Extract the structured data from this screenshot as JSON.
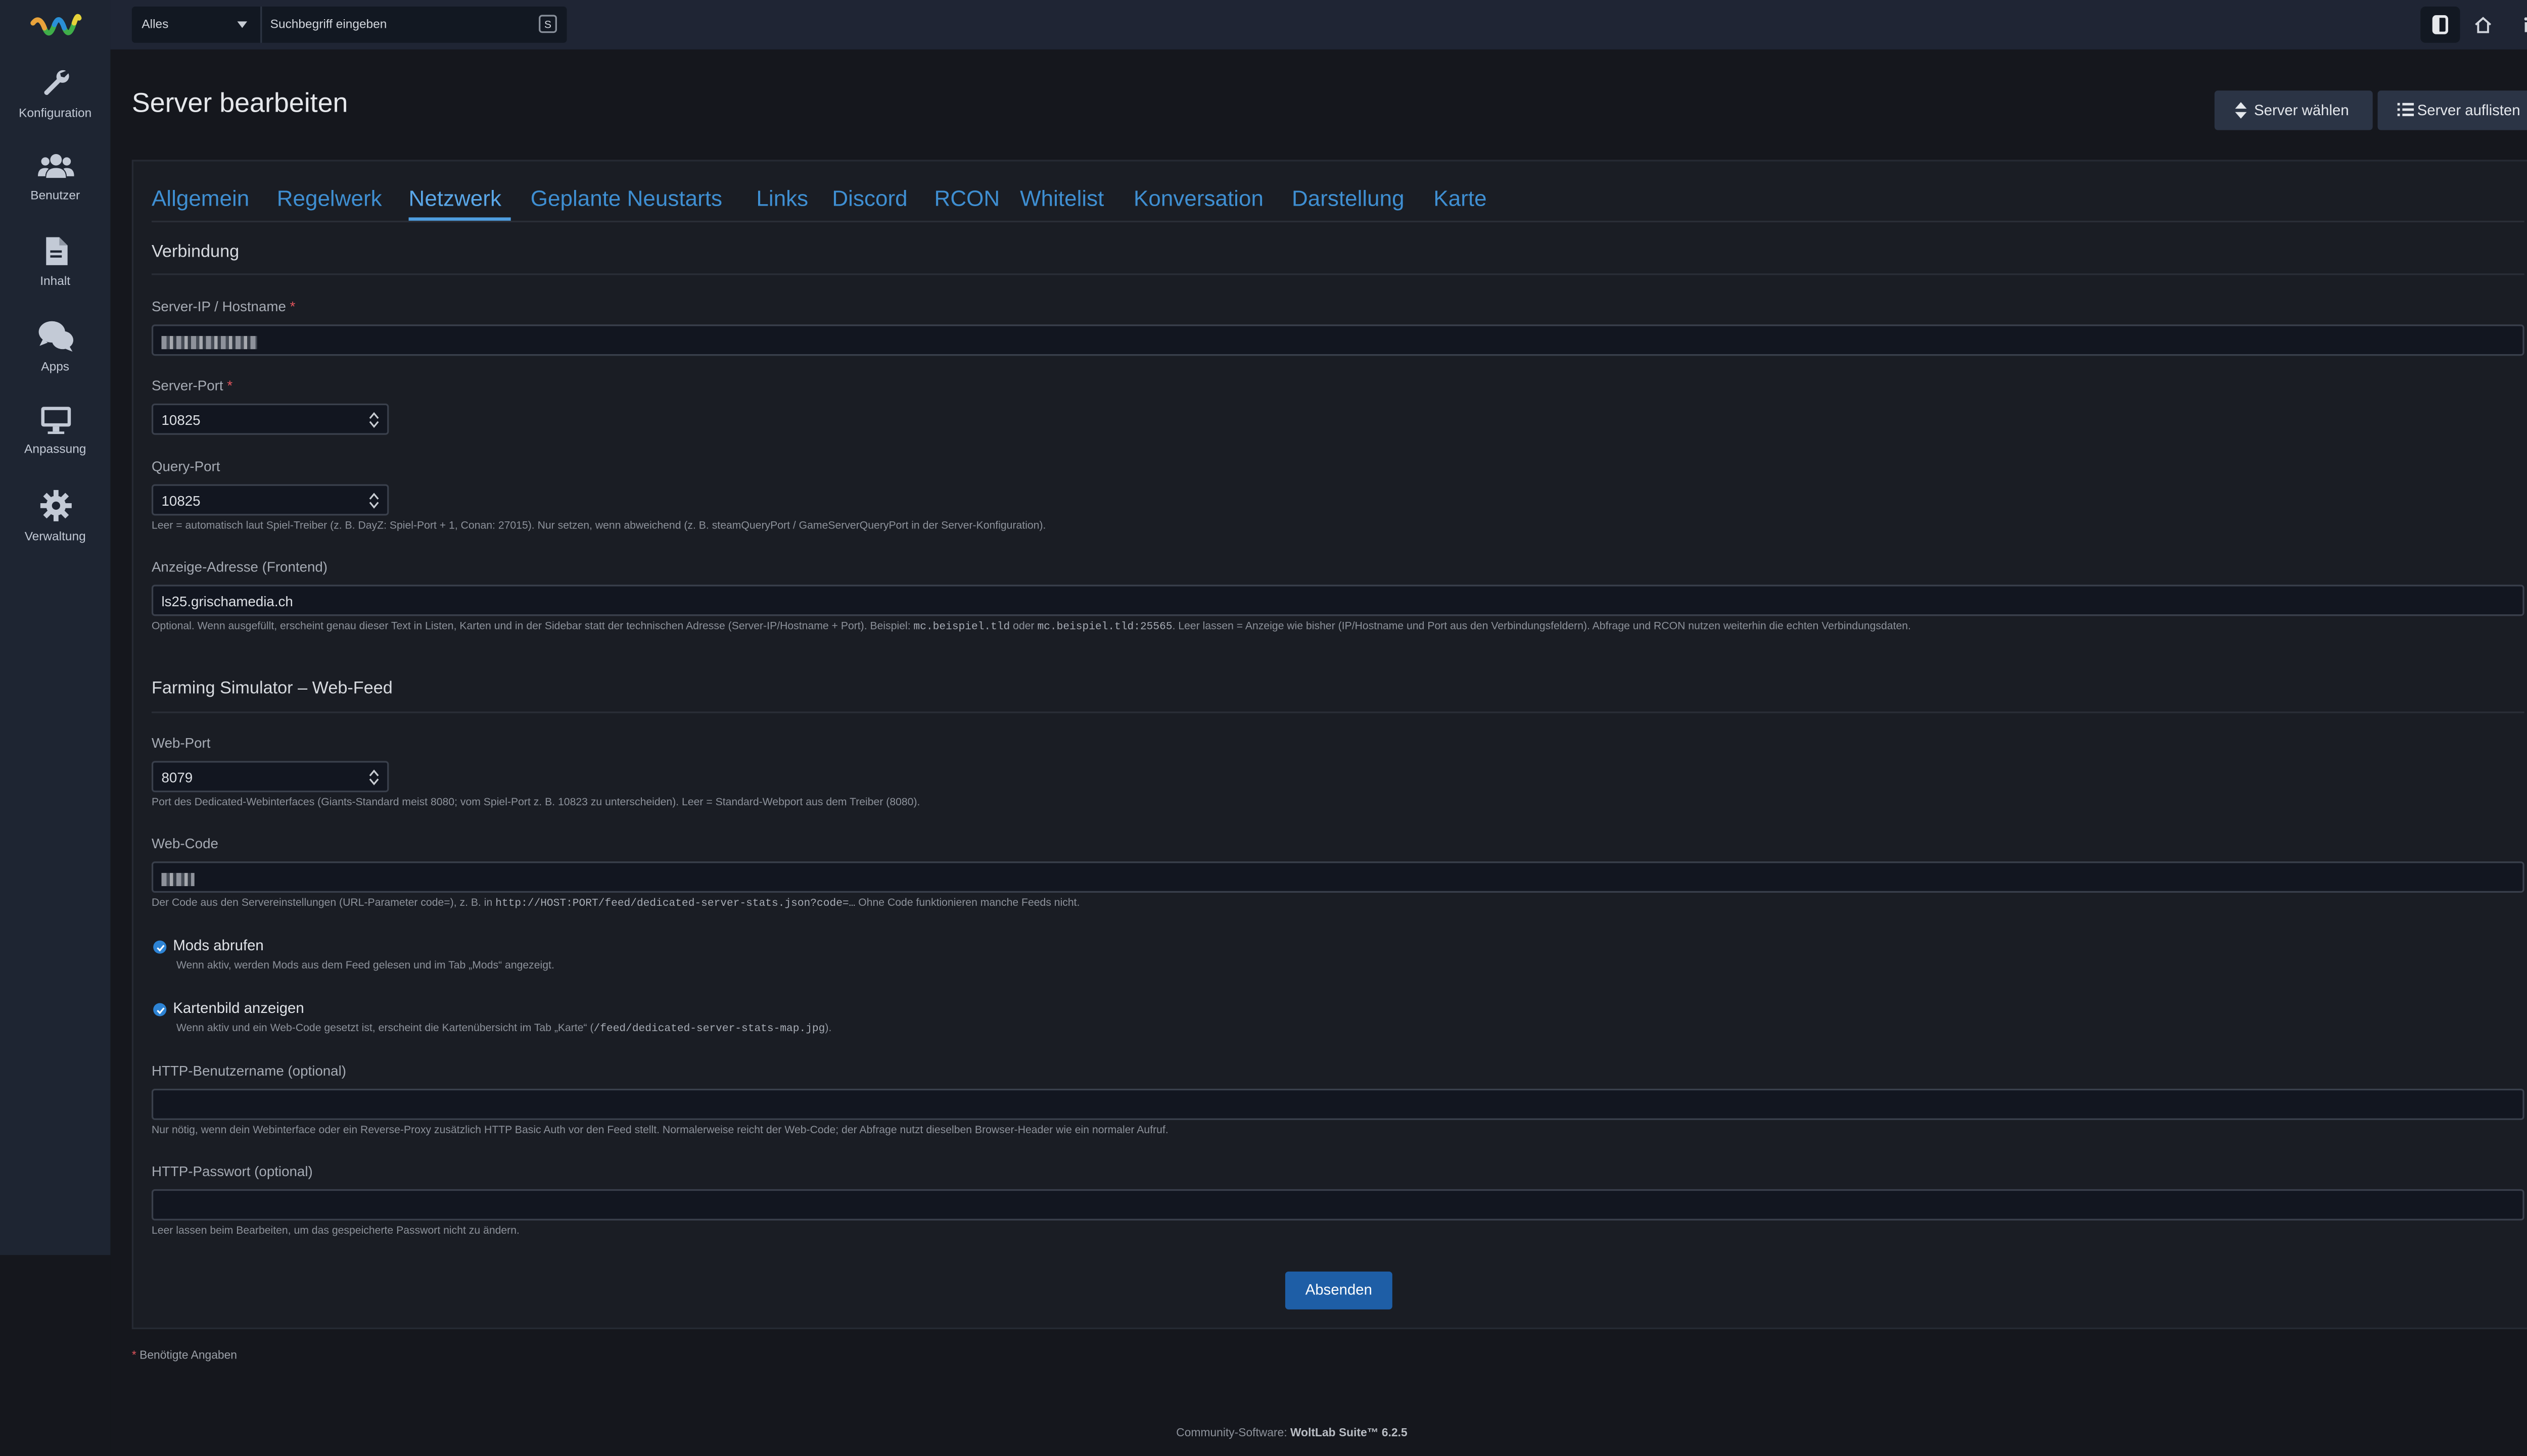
{
  "sidebar": {
    "items": [
      {
        "label": "Konfiguration",
        "icon": "wrench-icon"
      },
      {
        "label": "Benutzer",
        "icon": "users-icon"
      },
      {
        "label": "Inhalt",
        "icon": "document-icon"
      },
      {
        "label": "Apps",
        "icon": "comments-icon"
      },
      {
        "label": "Anpassung",
        "icon": "monitor-icon"
      },
      {
        "label": "Verwaltung",
        "icon": "gear-icon"
      }
    ]
  },
  "topbar": {
    "search_scope": "Alles",
    "search_placeholder": "Suchbegriff eingeben",
    "search_shortcut": "S",
    "icons": [
      "toggle-icon",
      "home-icon",
      "info-icon"
    ]
  },
  "page": {
    "title": "Server bearbeiten",
    "btn_select": "Server wählen",
    "btn_list": "Server auflisten"
  },
  "tabs": [
    "Allgemein",
    "Regelwerk",
    "Netzwerk",
    "Geplante Neustarts",
    "Links",
    "Discord",
    "RCON",
    "Whitelist",
    "Konversation",
    "Darstellung",
    "Karte"
  ],
  "active_tab": "Netzwerk",
  "connection": {
    "title": "Verbindung",
    "server_ip_label": "Server-IP / Hostname",
    "server_port_label": "Server-Port",
    "server_port": "10825",
    "query_port_label": "Query-Port",
    "query_port": "10825",
    "query_help": "Leer = automatisch laut Spiel-Treiber (z. B. DayZ: Spiel-Port + 1, Conan: 27015). Nur setzen, wenn abweichend (z. B. steamQueryPort / GameServerQueryPort in der Server-Konfiguration).",
    "display_label": "Anzeige-Adresse (Frontend)",
    "display_value": "ls25.grischamedia.ch",
    "display_help_1": "Optional. Wenn ausgefüllt, erscheint genau dieser Text in Listen, Karten und in der Sidebar statt der technischen Adresse (Server-IP/Hostname + Port). Beispiel: ",
    "display_help_code1": "mc.beispiel.tld",
    "display_help_2": " oder ",
    "display_help_code2": "mc.beispiel.tld:25565",
    "display_help_3": ". Leer lassen = Anzeige wie bisher (IP/Hostname und Port aus den Verbindungsfeldern). Abfrage und RCON nutzen weiterhin die echten Verbindungsdaten."
  },
  "webfeed": {
    "title": "Farming Simulator – Web-Feed",
    "web_port_label": "Web-Port",
    "web_port": "8079",
    "web_port_help": "Port des Dedicated-Webinterfaces (Giants-Standard meist 8080; vom Spiel-Port z. B. 10823 zu unterscheiden). Leer = Standard-Webport aus dem Treiber (8080).",
    "web_code_label": "Web-Code",
    "web_code_help_1": "Der Code aus den Servereinstellungen (URL-Parameter code=), z. B. in ",
    "web_code_help_code": "http://HOST:PORT/feed/dedicated-server-stats.json?code=…",
    "web_code_help_2": " Ohne Code funktionieren manche Feeds nicht.",
    "mods_label": "Mods abrufen",
    "mods_checked": true,
    "mods_help": "Wenn aktiv, werden Mods aus dem Feed gelesen und im Tab „Mods“ angezeigt.",
    "map_label": "Kartenbild anzeigen",
    "map_checked": true,
    "map_help_1": "Wenn aktiv und ein Web-Code gesetzt ist, erscheint die Kartenübersicht im Tab „Karte“ (",
    "map_help_code": "/feed/dedicated-server-stats-map.jpg",
    "map_help_2": ").",
    "http_user_label": "HTTP-Benutzername (optional)",
    "http_user_help": "Nur nötig, wenn dein Webinterface oder ein Reverse-Proxy zusätzlich HTTP Basic Auth vor den Feed stellt. Normalerweise reicht der Web-Code; der Abfrage nutzt dieselben Browser-Header wie ein normaler Aufruf.",
    "http_pass_label": "HTTP-Passwort (optional)",
    "http_pass_help": "Leer lassen beim Bearbeiten, um das gespeicherte Passwort nicht zu ändern."
  },
  "submit_label": "Absenden",
  "footnote": "Benötigte Angaben",
  "footer_prefix": "Community-Software: ",
  "footer_brand": "WoltLab Suite™ 6.2.5",
  "colors": {
    "accent": "#3f8fd2",
    "submit": "#1e5ea6",
    "required": "#e1545c",
    "checkbox": "#2d83d4"
  }
}
